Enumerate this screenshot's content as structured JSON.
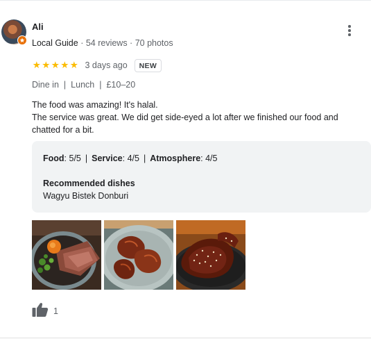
{
  "review": {
    "reviewer_name": "Ali",
    "reviewer_role": "Local Guide",
    "reviews_count": "54 reviews",
    "photos_count": "70 photos",
    "meta_separator": " · ",
    "rating": 5,
    "date": "3 days ago",
    "badge": "NEW",
    "details": [
      "Dine in",
      "Lunch",
      "£10–20"
    ],
    "detail_separator": "|",
    "text_lines": [
      "The food was amazing! It's halal.",
      "The service was great. We did get side-eyed a lot after we finished our food and chatted for a bit."
    ],
    "scores": [
      {
        "label": "Food",
        "value": "5/5"
      },
      {
        "label": "Service",
        "value": "4/5"
      },
      {
        "label": "Atmosphere",
        "value": "4/5"
      }
    ],
    "recommended_label": "Recommended dishes",
    "recommended_value": "Wagyu Bistek Donburi",
    "photos": [
      {
        "name": "review-photo-wagyu-donburi"
      },
      {
        "name": "review-photo-glazed-wings"
      },
      {
        "name": "review-photo-sesame-glazed-meat"
      }
    ],
    "like_count": "1",
    "icons": {
      "avatar_badge": "local-guide-badge-icon",
      "more": "more-vert-icon",
      "like": "thumbs-up-icon",
      "star": "star-icon"
    },
    "colors": {
      "star": "#fbbc04",
      "badge": "#e8710a",
      "text": "#202124",
      "muted": "#5f6368",
      "box_bg": "#f1f3f4"
    }
  }
}
